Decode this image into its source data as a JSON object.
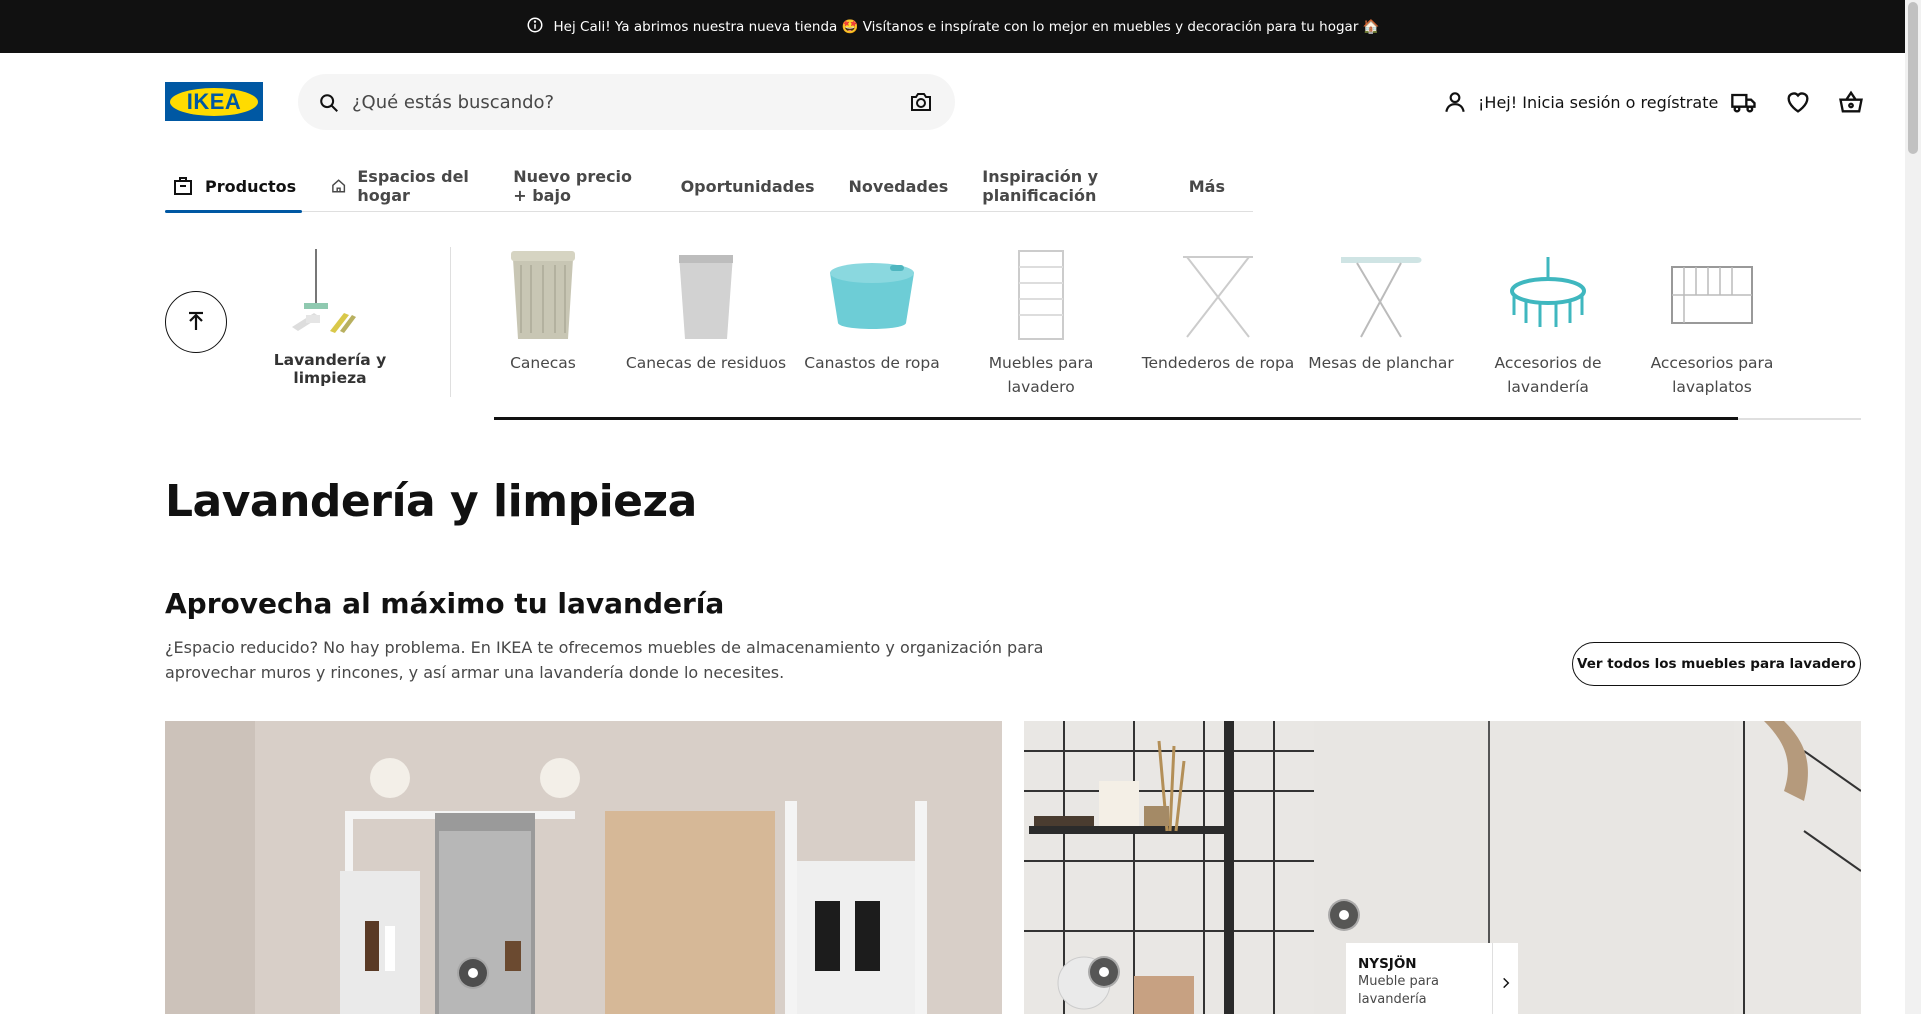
{
  "banner": {
    "text": "Hej Cali! Ya abrimos nuestra nueva tienda 🤩 Visítanos e inspírate con lo mejor en muebles y decoración para tu hogar 🏠"
  },
  "header": {
    "logo_text": "IKEA",
    "search_placeholder": "¿Qué estás buscando?",
    "account_label": "¡Hej! Inicia sesión o regístrate"
  },
  "nav": {
    "items": [
      {
        "label": "Productos",
        "active": true
      },
      {
        "label": "Espacios del hogar"
      },
      {
        "label": "Nuevo precio + bajo"
      },
      {
        "label": "Oportunidades"
      },
      {
        "label": "Novedades"
      },
      {
        "label": "Inspiración y planificación"
      },
      {
        "label": "Más"
      }
    ]
  },
  "categories": {
    "current": "Lavandería y limpieza",
    "items": [
      "Canecas",
      "Canecas de residuos",
      "Canastos de ropa",
      "Muebles para lavadero",
      "Tendederos de ropa",
      "Mesas de planchar",
      "Accesorios de lavandería",
      "Accesorios para lavaplatos"
    ],
    "scroll_progress": 0.91
  },
  "page": {
    "title": "Lavandería y limpieza",
    "section_title": "Aprovecha al máximo tu lavandería",
    "section_desc": "¿Espacio reducido? No hay problema. En IKEA te ofrecemos muebles de almacenamiento y organización para aprovechar muros y rincones, y así armar una lavandería donde lo necesites.",
    "cta_label": "Ver todos los muebles para lavadero"
  },
  "product_tag": {
    "name": "NYSJÖN",
    "desc": "Mueble para lavandería"
  },
  "colors": {
    "banner_bg": "#111111",
    "brand_blue": "#0058a3",
    "brand_yellow": "#ffdb00",
    "active_underline": "#0058a3"
  }
}
